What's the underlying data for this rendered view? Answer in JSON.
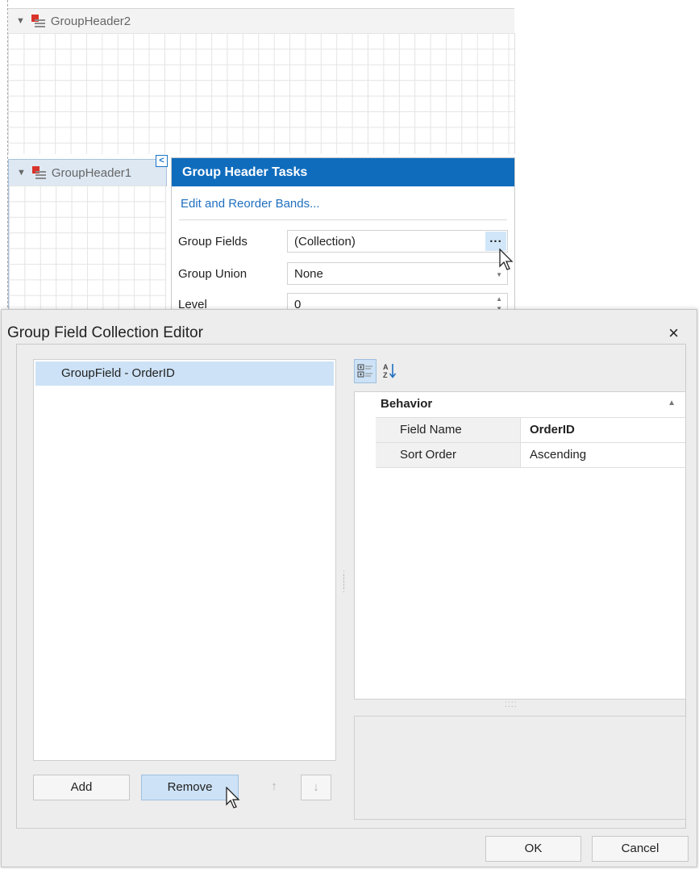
{
  "designer": {
    "band2_label": "GroupHeader2",
    "band1_label": "GroupHeader1",
    "smart_tag_glyph": "<",
    "expand_glyph": "▼"
  },
  "tasks_panel": {
    "title": "Group Header Tasks",
    "link": "Edit and Reorder Bands...",
    "rows": [
      {
        "label": "Group Fields",
        "value": "(Collection)"
      },
      {
        "label": "Group Union",
        "value": "None"
      },
      {
        "label": "Level",
        "value": "0"
      }
    ],
    "ellipsis": "..."
  },
  "dialog": {
    "title": "Group Field Collection Editor",
    "close_glyph": "×",
    "list_items": [
      "GroupField - OrderID"
    ],
    "buttons": {
      "add": "Add",
      "remove": "Remove",
      "move_up": "↑",
      "move_down": "↓",
      "ok": "OK",
      "cancel": "Cancel"
    },
    "property_grid": {
      "category": "Behavior",
      "collapse_glyph": "▲",
      "rows": [
        {
          "name": "Field Name",
          "value": "OrderID"
        },
        {
          "name": "Sort Order",
          "value": "Ascending"
        }
      ],
      "sort_alpha_glyph": "A↓"
    }
  },
  "colors": {
    "accent": "#0f6cbd",
    "selection": "#cde2f6",
    "band_icon": "#d9342b"
  },
  "icons": [
    "expand-triangle-icon",
    "band-icon",
    "smart-tag-icon",
    "categorized-icon",
    "sort-alphabetical-icon",
    "close-icon",
    "arrow-up-icon",
    "arrow-down-icon",
    "mouse-cursor-icon"
  ]
}
